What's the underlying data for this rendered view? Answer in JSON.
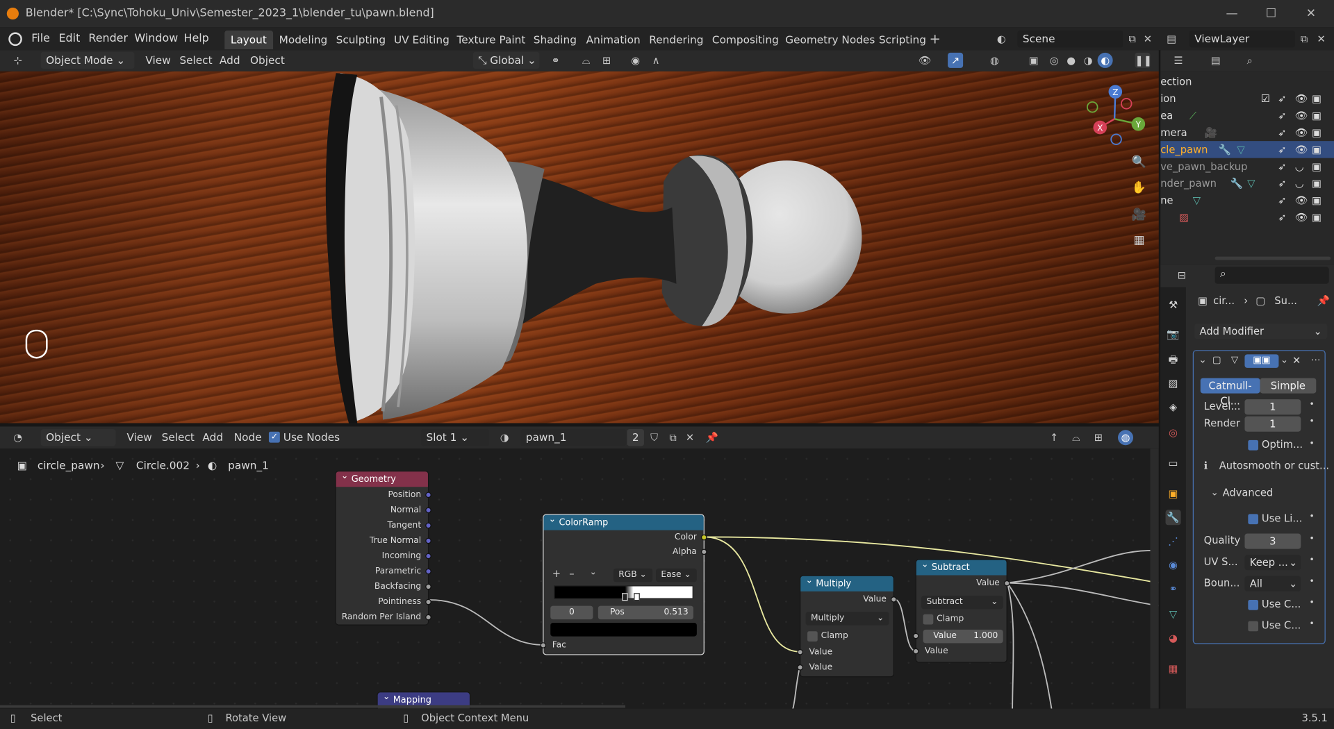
{
  "window": {
    "title": "Blender* [C:\\Sync\\Tohoku_Univ\\Semester_2023_1\\blender_tu\\pawn.blend]",
    "minimize": "—",
    "maximize": "☐",
    "close": "✕"
  },
  "menu": [
    "File",
    "Edit",
    "Render",
    "Window",
    "Help"
  ],
  "workspaces": [
    "Layout",
    "Modeling",
    "Sculpting",
    "UV Editing",
    "Texture Paint",
    "Shading",
    "Animation",
    "Rendering",
    "Compositing",
    "Geometry Nodes",
    "Scripting"
  ],
  "active_workspace": "Layout",
  "scene": {
    "name": "Scene",
    "view_layer": "ViewLayer"
  },
  "viewport_header": {
    "mode": "Object Mode",
    "menus": [
      "View",
      "Select",
      "Add",
      "Object"
    ],
    "orientation": "Global"
  },
  "gizmo": {
    "z": "Z",
    "y": "Y",
    "x": "X"
  },
  "node_header": {
    "editor": "Object",
    "menus": [
      "View",
      "Select",
      "Add",
      "Node"
    ],
    "use_nodes": "Use Nodes",
    "slot": "Slot 1",
    "material": "pawn_1",
    "users": "2"
  },
  "breadcrumb": {
    "object": "circle_pawn",
    "mesh": "Circle.002",
    "material": "pawn_1"
  },
  "nodes": {
    "geometry": {
      "title": "Geometry",
      "outputs": [
        "Position",
        "Normal",
        "Tangent",
        "True Normal",
        "Incoming",
        "Parametric",
        "Backfacing",
        "Pointiness",
        "Random Per Island"
      ]
    },
    "colorramp": {
      "title": "ColorRamp",
      "out_color": "Color",
      "out_alpha": "Alpha",
      "mode": "RGB",
      "interp": "Ease",
      "index": "0",
      "pos_label": "Pos",
      "pos_value": "0.513",
      "in_fac": "Fac"
    },
    "multiply": {
      "title": "Multiply",
      "out": "Value",
      "op": "Multiply",
      "clamp": "Clamp",
      "in1": "Value",
      "in2": "Value"
    },
    "subtract": {
      "title": "Subtract",
      "out": "Value",
      "op": "Subtract",
      "clamp": "Clamp",
      "in_label": "Value",
      "in_value": "1.000",
      "in2": "Value"
    },
    "mapping": {
      "title": "Mapping"
    }
  },
  "outliner": {
    "rows": [
      {
        "label": "ection"
      },
      {
        "label": "ion"
      },
      {
        "label": "ea"
      },
      {
        "label": "mera"
      },
      {
        "label": "cle_pawn"
      },
      {
        "label": "ve_pawn_backup"
      },
      {
        "label": "nder_pawn"
      },
      {
        "label": "ne"
      },
      {
        "label": ""
      }
    ]
  },
  "properties": {
    "breadcrumb_obj": "cir...",
    "breadcrumb_mod": "Su...",
    "add_modifier": "Add Modifier",
    "tab_catmull": "Catmull-Cl...",
    "tab_simple": "Simple",
    "levels_label": "Level...",
    "levels": "1",
    "render_label": "Render",
    "render": "1",
    "optim": "Optim...",
    "info": "Autosmooth or cust...",
    "advanced": "Advanced",
    "use_limit": "Use Li...",
    "quality_label": "Quality",
    "quality": "3",
    "uv_label": "UV S...",
    "uv": "Keep ...",
    "boundary_label": "Boun...",
    "boundary": "All",
    "use_c1": "Use C...",
    "use_c2": "Use C..."
  },
  "status": {
    "select": "Select",
    "rotate": "Rotate View",
    "context": "Object Context Menu",
    "version": "3.5.1"
  },
  "colors": {
    "accent": "#4772b3",
    "geometry_header": "#83314a",
    "converter_header": "#246283",
    "vector_header": "#3c3c83"
  }
}
